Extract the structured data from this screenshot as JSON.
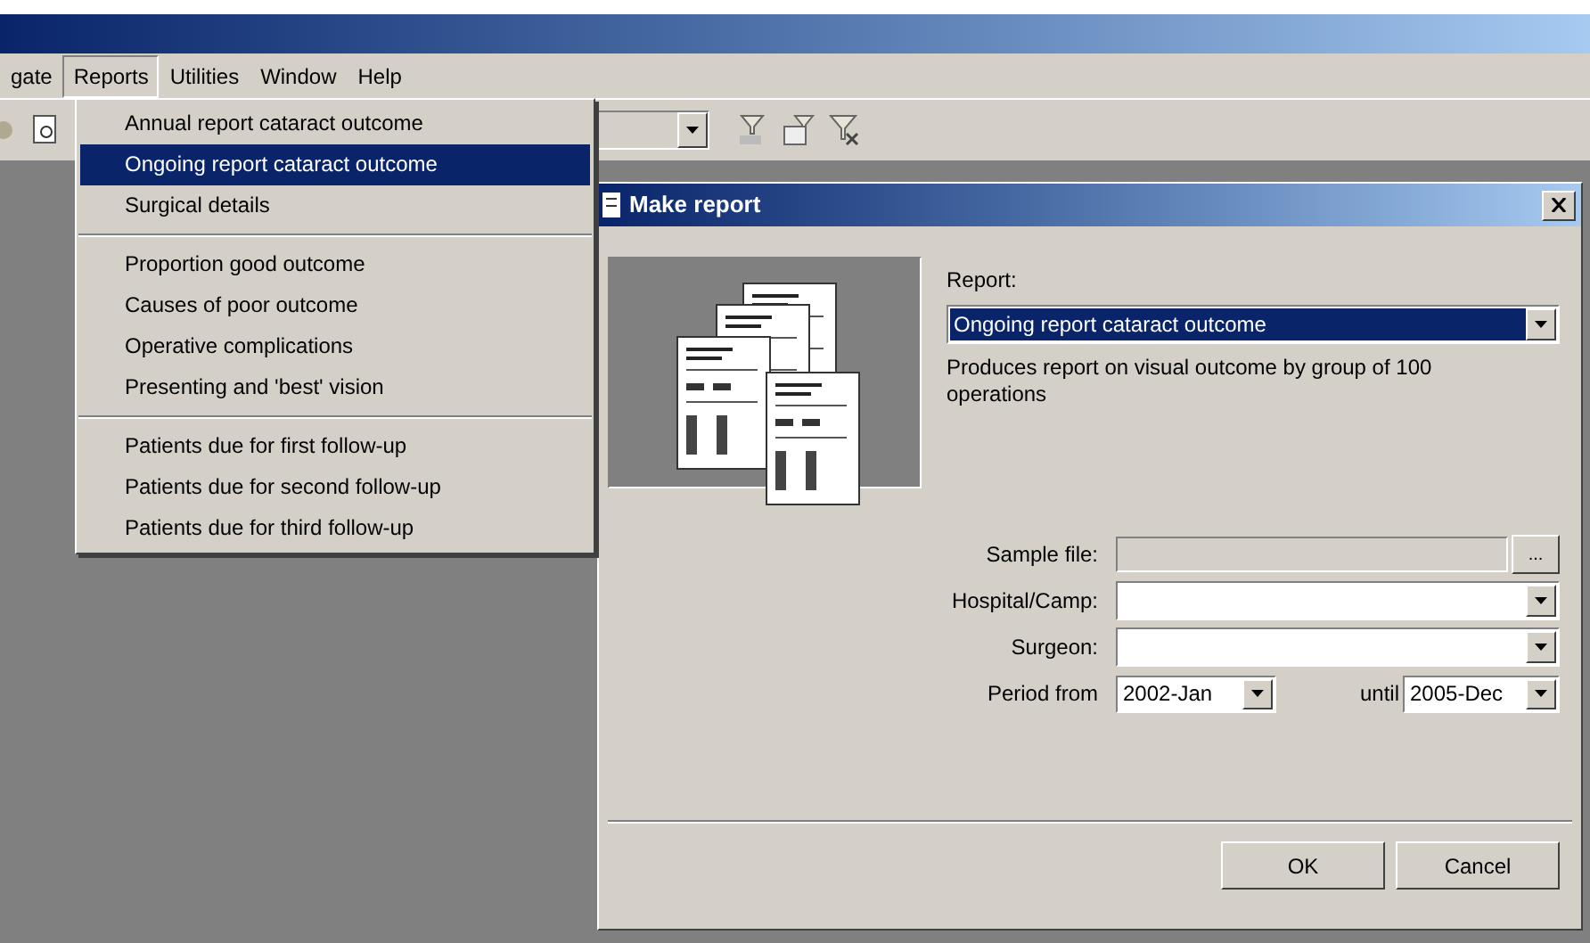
{
  "menu_bar": [
    {
      "label": "gate",
      "selected": false
    },
    {
      "label": "Reports",
      "selected": true
    },
    {
      "label": "Utilities",
      "selected": false
    },
    {
      "label": "Window",
      "selected": false
    },
    {
      "label": "Help",
      "selected": false
    }
  ],
  "reports_menu": [
    [
      {
        "label": "Annual report cataract outcome",
        "selected": false
      },
      {
        "label": "Ongoing report cataract outcome",
        "selected": true
      },
      {
        "label": "Surgical details",
        "selected": false
      }
    ],
    [
      {
        "label": "Proportion good outcome",
        "selected": false
      },
      {
        "label": "Causes of poor outcome",
        "selected": false
      },
      {
        "label": "Operative complications",
        "selected": false
      },
      {
        "label": "Presenting and 'best' vision",
        "selected": false
      }
    ],
    [
      {
        "label": "Patients due for first follow-up",
        "selected": false
      },
      {
        "label": "Patients due for second follow-up",
        "selected": false
      },
      {
        "label": "Patients due for third follow-up",
        "selected": false
      }
    ]
  ],
  "dialog": {
    "title": "Make report",
    "report_label": "Report:",
    "report_value": "Ongoing report cataract outcome",
    "description": "Produces report on visual outcome by group of 100 operations",
    "fields": [
      {
        "kind": "file",
        "label": "Sample file:",
        "button": "..."
      },
      {
        "kind": "combo",
        "label": "Hospital/Camp:"
      },
      {
        "kind": "combo",
        "label": "Surgeon:"
      },
      {
        "kind": "range",
        "label": "Period from",
        "from": "2002-Jan",
        "until_label": "until",
        "to": "2005-Dec"
      }
    ],
    "buttons": [
      "OK",
      "Cancel"
    ]
  }
}
